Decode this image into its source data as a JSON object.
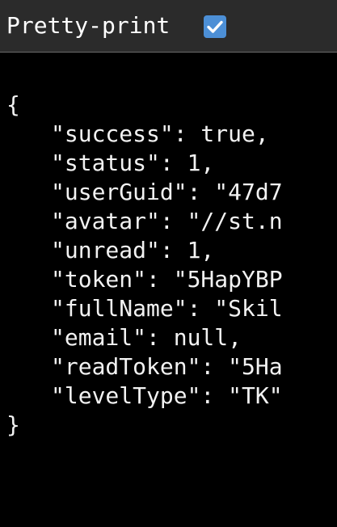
{
  "toolbar": {
    "label": "Pretty-print",
    "checkbox_checked": true,
    "checkbox_icon": "checkmark-icon",
    "accent_color": "#4c8fd6"
  },
  "json_view": {
    "open_brace": "{",
    "lines": [
      "\"success\": true,",
      "\"status\": 1,",
      "\"userGuid\": \"47d7",
      "\"avatar\": \"//st.n",
      "\"unread\": 1,",
      "\"token\": \"5HapYBP",
      "\"fullName\": \"Skil",
      "\"email\": null,",
      "\"readToken\": \"5Ha",
      "\"levelType\": \"TK\""
    ],
    "close_brace": "}"
  }
}
